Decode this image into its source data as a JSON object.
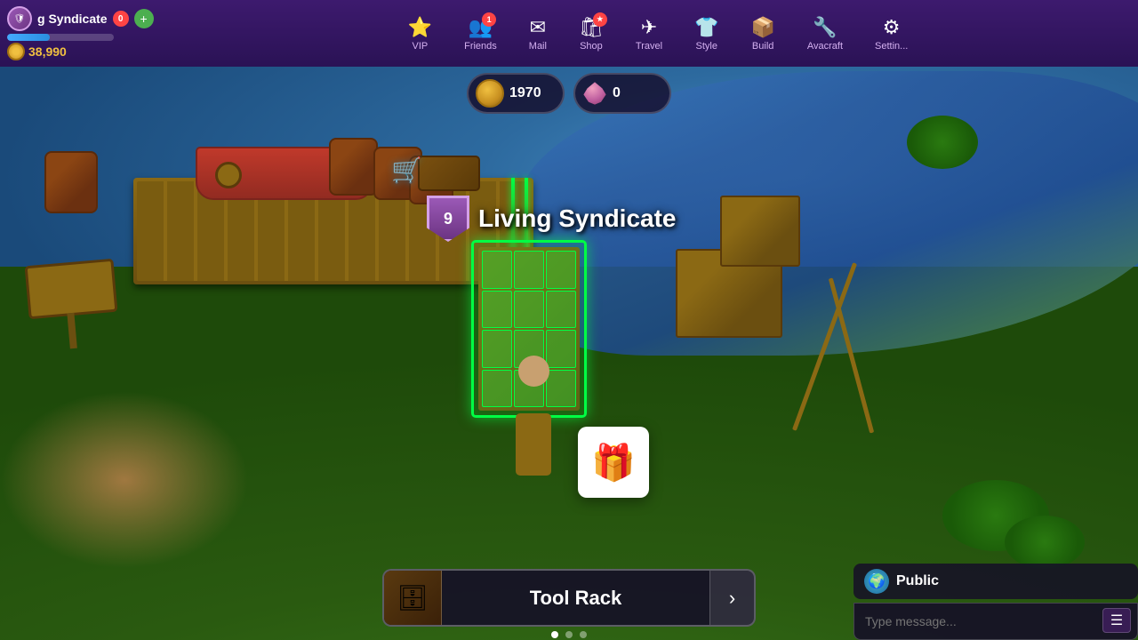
{
  "player": {
    "name": "g Syndicate",
    "currency": "38,990",
    "xp_percent": 40
  },
  "header": {
    "currency_gold": "1970",
    "currency_gem": "0"
  },
  "guild": {
    "level": "9",
    "name": "Living Syndicate"
  },
  "nav": {
    "items": [
      {
        "id": "vip",
        "label": "VIP",
        "icon": "⭐"
      },
      {
        "id": "friends",
        "label": "Friends",
        "icon": "👥",
        "badge": "1"
      },
      {
        "id": "mail",
        "label": "Mail",
        "icon": "✉"
      },
      {
        "id": "shop",
        "label": "Shop",
        "icon": "🛍",
        "badge": "★"
      },
      {
        "id": "travel",
        "label": "Travel",
        "icon": "✈"
      },
      {
        "id": "style",
        "label": "Style",
        "icon": "👕"
      },
      {
        "id": "build",
        "label": "Build",
        "icon": "📦"
      },
      {
        "id": "avacraft",
        "label": "Avacraft",
        "icon": "🔧"
      },
      {
        "id": "settings",
        "label": "Settin...",
        "icon": "⚙"
      }
    ]
  },
  "bottom_bar": {
    "item_name": "Tool Rack",
    "item_icon": "🗄",
    "arrow_label": "›",
    "dots": [
      "active",
      "inactive",
      "inactive"
    ]
  },
  "chat": {
    "channel": "Public",
    "message_placeholder": "Type message..."
  }
}
